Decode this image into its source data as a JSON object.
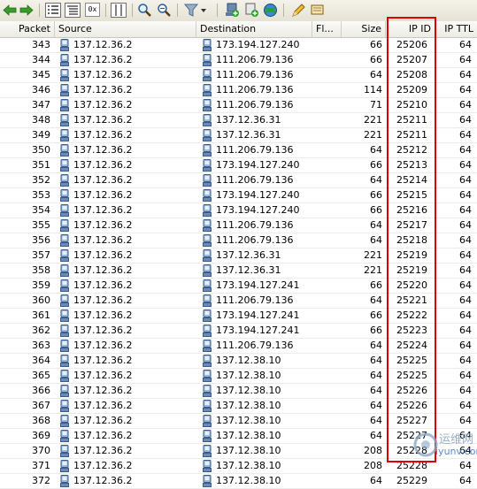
{
  "columns": {
    "packet": "Packet",
    "source": "Source",
    "destination": "Destination",
    "flags": "Fl...",
    "size": "Size",
    "ip_id": "IP ID",
    "ip_ttl": "IP TTL"
  },
  "rows": [
    {
      "packet": "343",
      "source": "137.12.36.2",
      "destination": "173.194.127.240",
      "size": "66",
      "ip_id": "25206",
      "ip_ttl": "64"
    },
    {
      "packet": "344",
      "source": "137.12.36.2",
      "destination": "111.206.79.136",
      "size": "66",
      "ip_id": "25207",
      "ip_ttl": "64"
    },
    {
      "packet": "345",
      "source": "137.12.36.2",
      "destination": "111.206.79.136",
      "size": "64",
      "ip_id": "25208",
      "ip_ttl": "64"
    },
    {
      "packet": "346",
      "source": "137.12.36.2",
      "destination": "111.206.79.136",
      "size": "114",
      "ip_id": "25209",
      "ip_ttl": "64"
    },
    {
      "packet": "347",
      "source": "137.12.36.2",
      "destination": "111.206.79.136",
      "size": "71",
      "ip_id": "25210",
      "ip_ttl": "64"
    },
    {
      "packet": "348",
      "source": "137.12.36.2",
      "destination": "137.12.36.31",
      "size": "221",
      "ip_id": "25211",
      "ip_ttl": "64"
    },
    {
      "packet": "349",
      "source": "137.12.36.2",
      "destination": "137.12.36.31",
      "size": "221",
      "ip_id": "25211",
      "ip_ttl": "64"
    },
    {
      "packet": "350",
      "source": "137.12.36.2",
      "destination": "111.206.79.136",
      "size": "64",
      "ip_id": "25212",
      "ip_ttl": "64"
    },
    {
      "packet": "351",
      "source": "137.12.36.2",
      "destination": "173.194.127.240",
      "size": "66",
      "ip_id": "25213",
      "ip_ttl": "64"
    },
    {
      "packet": "352",
      "source": "137.12.36.2",
      "destination": "111.206.79.136",
      "size": "64",
      "ip_id": "25214",
      "ip_ttl": "64"
    },
    {
      "packet": "353",
      "source": "137.12.36.2",
      "destination": "173.194.127.240",
      "size": "66",
      "ip_id": "25215",
      "ip_ttl": "64"
    },
    {
      "packet": "354",
      "source": "137.12.36.2",
      "destination": "173.194.127.240",
      "size": "66",
      "ip_id": "25216",
      "ip_ttl": "64"
    },
    {
      "packet": "355",
      "source": "137.12.36.2",
      "destination": "111.206.79.136",
      "size": "64",
      "ip_id": "25217",
      "ip_ttl": "64"
    },
    {
      "packet": "356",
      "source": "137.12.36.2",
      "destination": "111.206.79.136",
      "size": "64",
      "ip_id": "25218",
      "ip_ttl": "64"
    },
    {
      "packet": "357",
      "source": "137.12.36.2",
      "destination": "137.12.36.31",
      "size": "221",
      "ip_id": "25219",
      "ip_ttl": "64"
    },
    {
      "packet": "358",
      "source": "137.12.36.2",
      "destination": "137.12.36.31",
      "size": "221",
      "ip_id": "25219",
      "ip_ttl": "64"
    },
    {
      "packet": "359",
      "source": "137.12.36.2",
      "destination": "173.194.127.241",
      "size": "66",
      "ip_id": "25220",
      "ip_ttl": "64"
    },
    {
      "packet": "360",
      "source": "137.12.36.2",
      "destination": "111.206.79.136",
      "size": "64",
      "ip_id": "25221",
      "ip_ttl": "64"
    },
    {
      "packet": "361",
      "source": "137.12.36.2",
      "destination": "173.194.127.241",
      "size": "66",
      "ip_id": "25222",
      "ip_ttl": "64"
    },
    {
      "packet": "362",
      "source": "137.12.36.2",
      "destination": "173.194.127.241",
      "size": "66",
      "ip_id": "25223",
      "ip_ttl": "64"
    },
    {
      "packet": "363",
      "source": "137.12.36.2",
      "destination": "111.206.79.136",
      "size": "64",
      "ip_id": "25224",
      "ip_ttl": "64"
    },
    {
      "packet": "364",
      "source": "137.12.36.2",
      "destination": "137.12.38.10",
      "size": "64",
      "ip_id": "25225",
      "ip_ttl": "64"
    },
    {
      "packet": "365",
      "source": "137.12.36.2",
      "destination": "137.12.38.10",
      "size": "64",
      "ip_id": "25225",
      "ip_ttl": "64"
    },
    {
      "packet": "366",
      "source": "137.12.36.2",
      "destination": "137.12.38.10",
      "size": "64",
      "ip_id": "25226",
      "ip_ttl": "64"
    },
    {
      "packet": "367",
      "source": "137.12.36.2",
      "destination": "137.12.38.10",
      "size": "64",
      "ip_id": "25226",
      "ip_ttl": "64"
    },
    {
      "packet": "368",
      "source": "137.12.36.2",
      "destination": "137.12.38.10",
      "size": "64",
      "ip_id": "25227",
      "ip_ttl": "64"
    },
    {
      "packet": "369",
      "source": "137.12.36.2",
      "destination": "137.12.38.10",
      "size": "64",
      "ip_id": "25227",
      "ip_ttl": "64"
    },
    {
      "packet": "370",
      "source": "137.12.36.2",
      "destination": "137.12.38.10",
      "size": "208",
      "ip_id": "25228",
      "ip_ttl": "64"
    },
    {
      "packet": "371",
      "source": "137.12.36.2",
      "destination": "137.12.38.10",
      "size": "208",
      "ip_id": "25228",
      "ip_ttl": "64"
    },
    {
      "packet": "372",
      "source": "137.12.36.2",
      "destination": "137.12.38.10",
      "size": "64",
      "ip_id": "25229",
      "ip_ttl": "64"
    }
  ],
  "toolbar": {
    "hex_label": "0x"
  },
  "watermark": {
    "line1": "运维网",
    "line2": "iyunv.com"
  },
  "colors": {
    "highlight": "#e00000",
    "nav_arrows": "#3a9a2a"
  },
  "icons": [
    "back-arrow-icon",
    "forward-arrow-icon",
    "list-view-icon",
    "details-view-icon",
    "hex-view-icon",
    "columns-icon",
    "search-icon",
    "zoom-icon",
    "filter-icon",
    "add-host-icon",
    "add-packet-icon",
    "network-globe-icon",
    "edit-pencil-icon",
    "clear-icon",
    "host-computer-icon"
  ]
}
